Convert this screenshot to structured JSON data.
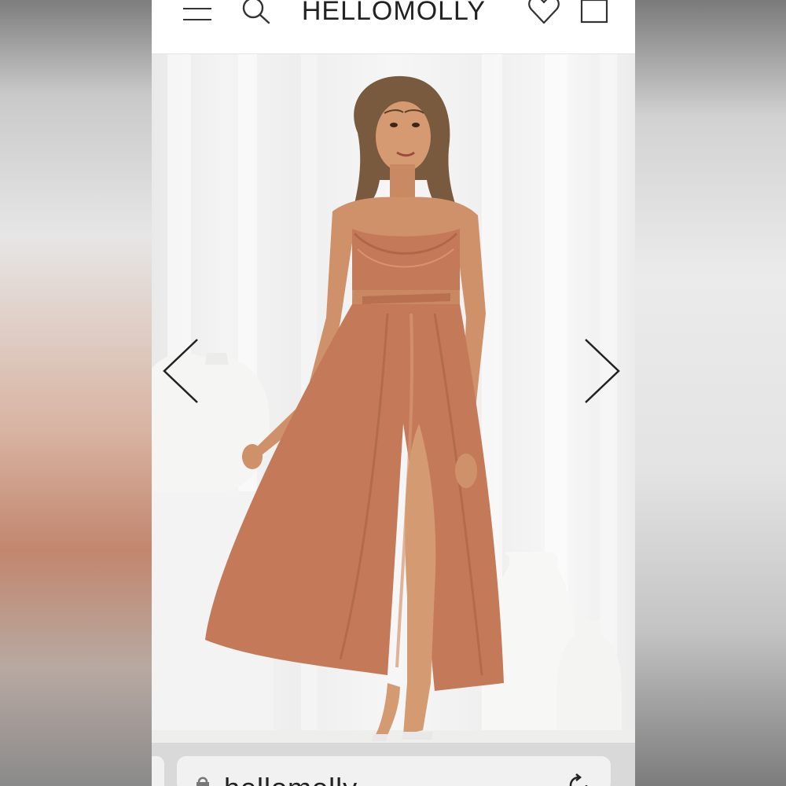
{
  "header": {
    "logo": "HELLOMOLLY",
    "icons": {
      "menu": "hamburger-menu-icon",
      "search": "search-icon",
      "wishlist": "heart-icon",
      "cart": "shopping-bag-icon"
    }
  },
  "gallery": {
    "image_alt": "Model wearing rust satin cowl neck maxi dress with cut-outs and thigh split",
    "prev_icon": "chevron-left-icon",
    "next_icon": "chevron-right-icon"
  },
  "browser": {
    "url": "hellomolly"
  },
  "colors": {
    "dress": "#c47a58",
    "background_page": "#ffffff",
    "header_text": "#222222",
    "chrome_bar": "#d9d9d9"
  }
}
